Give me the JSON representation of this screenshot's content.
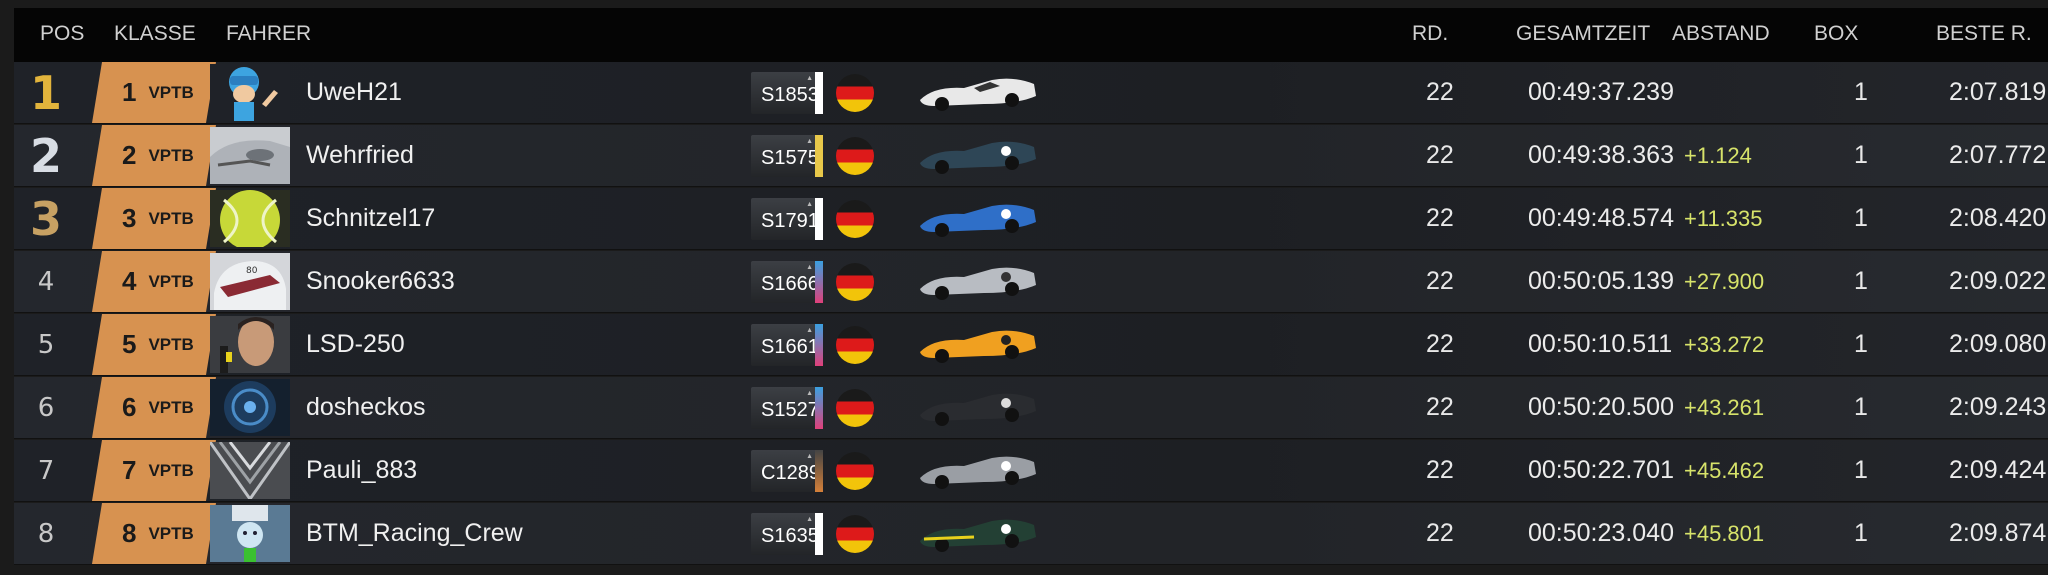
{
  "headers": {
    "pos": "POS",
    "klasse": "KLASSE",
    "fahrer": "FAHRER",
    "rd": "RD.",
    "gesamtzeit": "GESAMTZEIT",
    "abstand": "ABSTAND",
    "box": "BOX",
    "beste": "BESTE R."
  },
  "colors": {
    "class_badge": "#d79250",
    "gap_text": "#d7e36a",
    "gold": "#e2b43c",
    "silver": "#d8dde4",
    "bronze": "#c7a163"
  },
  "rows": [
    {
      "pos": "1",
      "class_pos": "1",
      "class": "VPTB",
      "driver": "UweH21",
      "safety": "S1853",
      "stripe": "#ffffff",
      "nation": "germany-flag",
      "car": "white-prototype",
      "rd": "22",
      "time": "00:49:37.239",
      "gap": "",
      "box": "1",
      "best": "2:07.819"
    },
    {
      "pos": "2",
      "class_pos": "2",
      "class": "VPTB",
      "driver": "Wehrfried",
      "safety": "S1575",
      "stripe": "#e8c84a",
      "nation": "germany-flag",
      "car": "dark-blue-prototype",
      "rd": "22",
      "time": "00:49:38.363",
      "gap": "+1.124",
      "box": "1",
      "best": "2:07.772"
    },
    {
      "pos": "3",
      "class_pos": "3",
      "class": "VPTB",
      "driver": "Schnitzel17",
      "safety": "S1791",
      "stripe": "#ffffff",
      "nation": "germany-flag",
      "car": "blue-prototype",
      "rd": "22",
      "time": "00:49:48.574",
      "gap": "+11.335",
      "box": "1",
      "best": "2:08.420"
    },
    {
      "pos": "4",
      "class_pos": "4",
      "class": "VPTB",
      "driver": "Snooker6633",
      "safety": "S1666",
      "stripe": "#e0407a",
      "nation": "germany-flag",
      "car": "silver-prototype",
      "rd": "22",
      "time": "00:50:05.139",
      "gap": "+27.900",
      "box": "1",
      "best": "2:09.022"
    },
    {
      "pos": "5",
      "class_pos": "5",
      "class": "VPTB",
      "driver": "LSD-250",
      "safety": "S1661",
      "stripe": "#e0407a",
      "nation": "germany-flag",
      "car": "orange-prototype",
      "rd": "22",
      "time": "00:50:10.511",
      "gap": "+33.272",
      "box": "1",
      "best": "2:09.080"
    },
    {
      "pos": "6",
      "class_pos": "6",
      "class": "VPTB",
      "driver": "dosheckos",
      "safety": "S1527",
      "stripe": "#e0407a",
      "nation": "germany-flag",
      "car": "black-prototype",
      "rd": "22",
      "time": "00:50:20.500",
      "gap": "+43.261",
      "box": "1",
      "best": "2:09.243"
    },
    {
      "pos": "7",
      "class_pos": "7",
      "class": "VPTB",
      "driver": "Pauli_883",
      "safety": "C1289",
      "stripe": "#d4803a",
      "nation": "germany-flag",
      "car": "grey-prototype",
      "rd": "22",
      "time": "00:50:22.701",
      "gap": "+45.462",
      "box": "1",
      "best": "2:09.424"
    },
    {
      "pos": "8",
      "class_pos": "8",
      "class": "VPTB",
      "driver": "BTM_Racing_Crew",
      "safety": "S1635",
      "stripe": "#ffffff",
      "nation": "germany-flag",
      "car": "green-prototype",
      "rd": "22",
      "time": "00:50:23.040",
      "gap": "+45.801",
      "box": "1",
      "best": "2:09.874"
    }
  ]
}
